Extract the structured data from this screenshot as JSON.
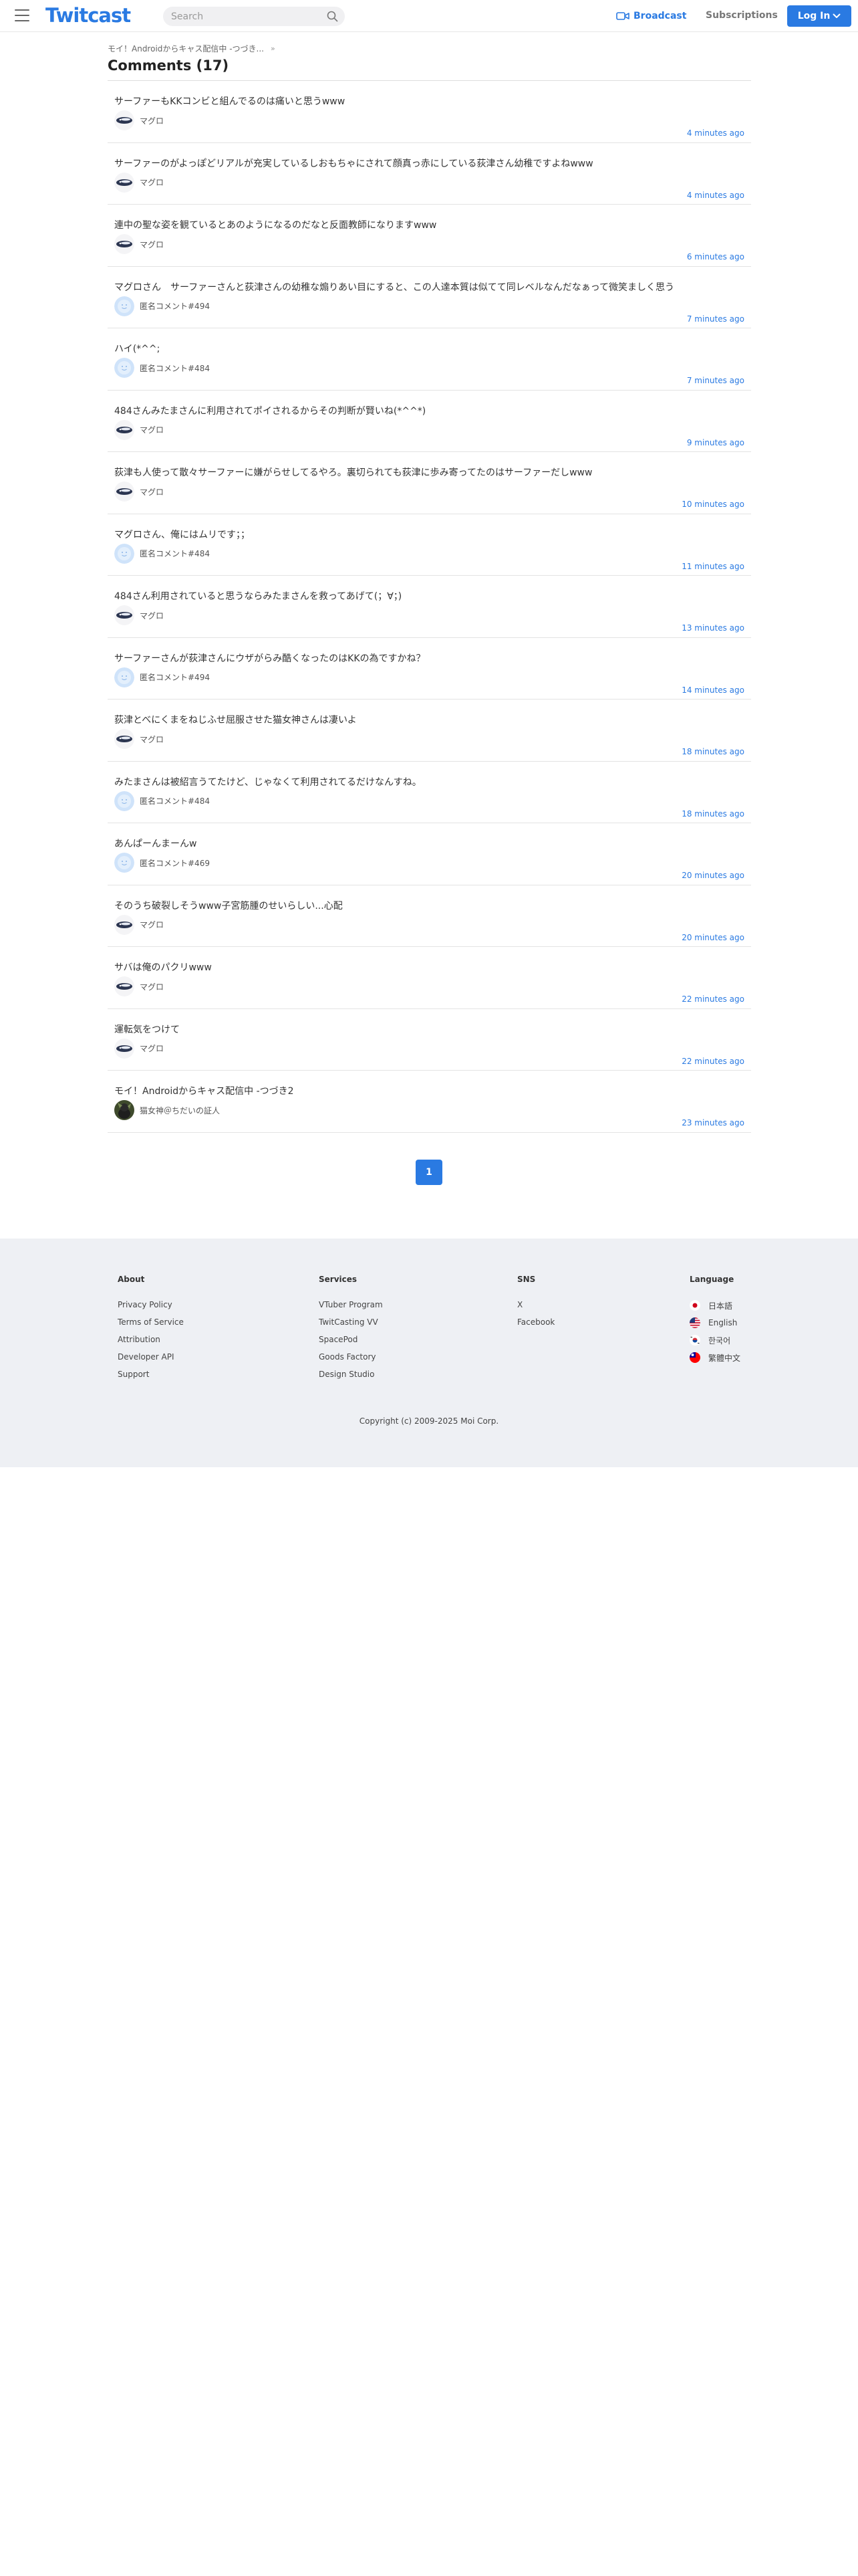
{
  "header": {
    "logo": "Twitcast",
    "search_placeholder": "Search",
    "broadcast": "Broadcast",
    "subscriptions": "Subscriptions",
    "login": "Log In"
  },
  "breadcrumb": {
    "text": "モイ！Androidからキャス配信中 -つづき...",
    "separator": "»"
  },
  "page_title": "Comments (17)",
  "comments": [
    {
      "text": "サーファーもKKコンビと組んでるのは痛いと思うwww",
      "user": "マグロ",
      "avatar": "maguro",
      "time": "4 minutes ago"
    },
    {
      "text": "サーファーのがよっぽどリアルが充実しているしおもちゃにされて顔真っ赤にしている荻津さん幼稚ですよねwww",
      "user": "マグロ",
      "avatar": "maguro",
      "time": "4 minutes ago"
    },
    {
      "text": "連中の聖な姿を観ているとあのようになるのだなと反面教師になりますwww",
      "user": "マグロ",
      "avatar": "maguro",
      "time": "6 minutes ago"
    },
    {
      "text": "マグロさん　サーファーさんと荻津さんの幼稚な煽りあい目にすると、この人達本質は似てて同レベルなんだなぁって微笑ましく思う",
      "user": "匿名コメント#494",
      "avatar": "anon",
      "time": "7 minutes ago"
    },
    {
      "text": "ハイ(*^^;",
      "user": "匿名コメント#484",
      "avatar": "anon",
      "time": "7 minutes ago"
    },
    {
      "text": "484さんみたまさんに利用されてポイされるからその判断が賢いね(*^^*)",
      "user": "マグロ",
      "avatar": "maguro",
      "time": "9 minutes ago"
    },
    {
      "text": "荻津も人使って散々サーファーに嫌がらせしてるやろ。裏切られても荻津に歩み寄ってたのはサーファーだしwww",
      "user": "マグロ",
      "avatar": "maguro",
      "time": "10 minutes ago"
    },
    {
      "text": "マグロさん、俺にはムリです；；",
      "user": "匿名コメント#484",
      "avatar": "anon",
      "time": "11 minutes ago"
    },
    {
      "text": "484さん利用されていると思うならみたまさんを救ってあげて(；∀；)",
      "user": "マグロ",
      "avatar": "maguro",
      "time": "13 minutes ago"
    },
    {
      "text": "サーファーさんが荻津さんにウザがらみ酷くなったのはKKの為ですかね？",
      "user": "匿名コメント#494",
      "avatar": "anon",
      "time": "14 minutes ago"
    },
    {
      "text": "荻津とべにくまをねじふせ屈服させた猫女神さんは凄いよ",
      "user": "マグロ",
      "avatar": "maguro",
      "time": "18 minutes ago"
    },
    {
      "text": "みたまさんは被紹言うてたけど、じゃなくて利用されてるだけなんすね。",
      "user": "匿名コメント#484",
      "avatar": "anon",
      "time": "18 minutes ago"
    },
    {
      "text": "あんぱーんまーんw",
      "user": "匿名コメント#469",
      "avatar": "anon",
      "time": "20 minutes ago"
    },
    {
      "text": "そのうち破裂しそうwww子宮筋腫のせいらしい...心配",
      "user": "マグロ",
      "avatar": "maguro",
      "time": "20 minutes ago"
    },
    {
      "text": "サバは俺のパクリwww",
      "user": "マグロ",
      "avatar": "maguro",
      "time": "22 minutes ago"
    },
    {
      "text": "運転気をつけて",
      "user": "マグロ",
      "avatar": "maguro",
      "time": "22 minutes ago"
    },
    {
      "text": "モイ！Androidからキャス配信中 -つづき2",
      "user": "猫女神＠ちだいの証人",
      "avatar": "neko",
      "time": "23 minutes ago"
    }
  ],
  "pagination": {
    "current": "1"
  },
  "footer": {
    "about": {
      "title": "About",
      "links": [
        "Privacy Policy",
        "Terms of Service",
        "Attribution",
        "Developer API",
        "Support"
      ]
    },
    "services": {
      "title": "Services",
      "links": [
        "VTuber Program",
        "TwitCasting VV",
        "SpacePod",
        "Goods Factory",
        "Design Studio"
      ]
    },
    "sns": {
      "title": "SNS",
      "links": [
        "X",
        "Facebook"
      ]
    },
    "language": {
      "title": "Language",
      "items": [
        {
          "label": "日本語",
          "flag": "jp"
        },
        {
          "label": "English",
          "flag": "us"
        },
        {
          "label": "한국어",
          "flag": "kr"
        },
        {
          "label": "繁體中文",
          "flag": "tw"
        }
      ]
    },
    "copyright": "Copyright (c) 2009-2025 Moi Corp."
  },
  "colors": {
    "accent": "#2a7ae2",
    "footer_bg": "#eef0f4",
    "divider": "#e3e3e3"
  }
}
